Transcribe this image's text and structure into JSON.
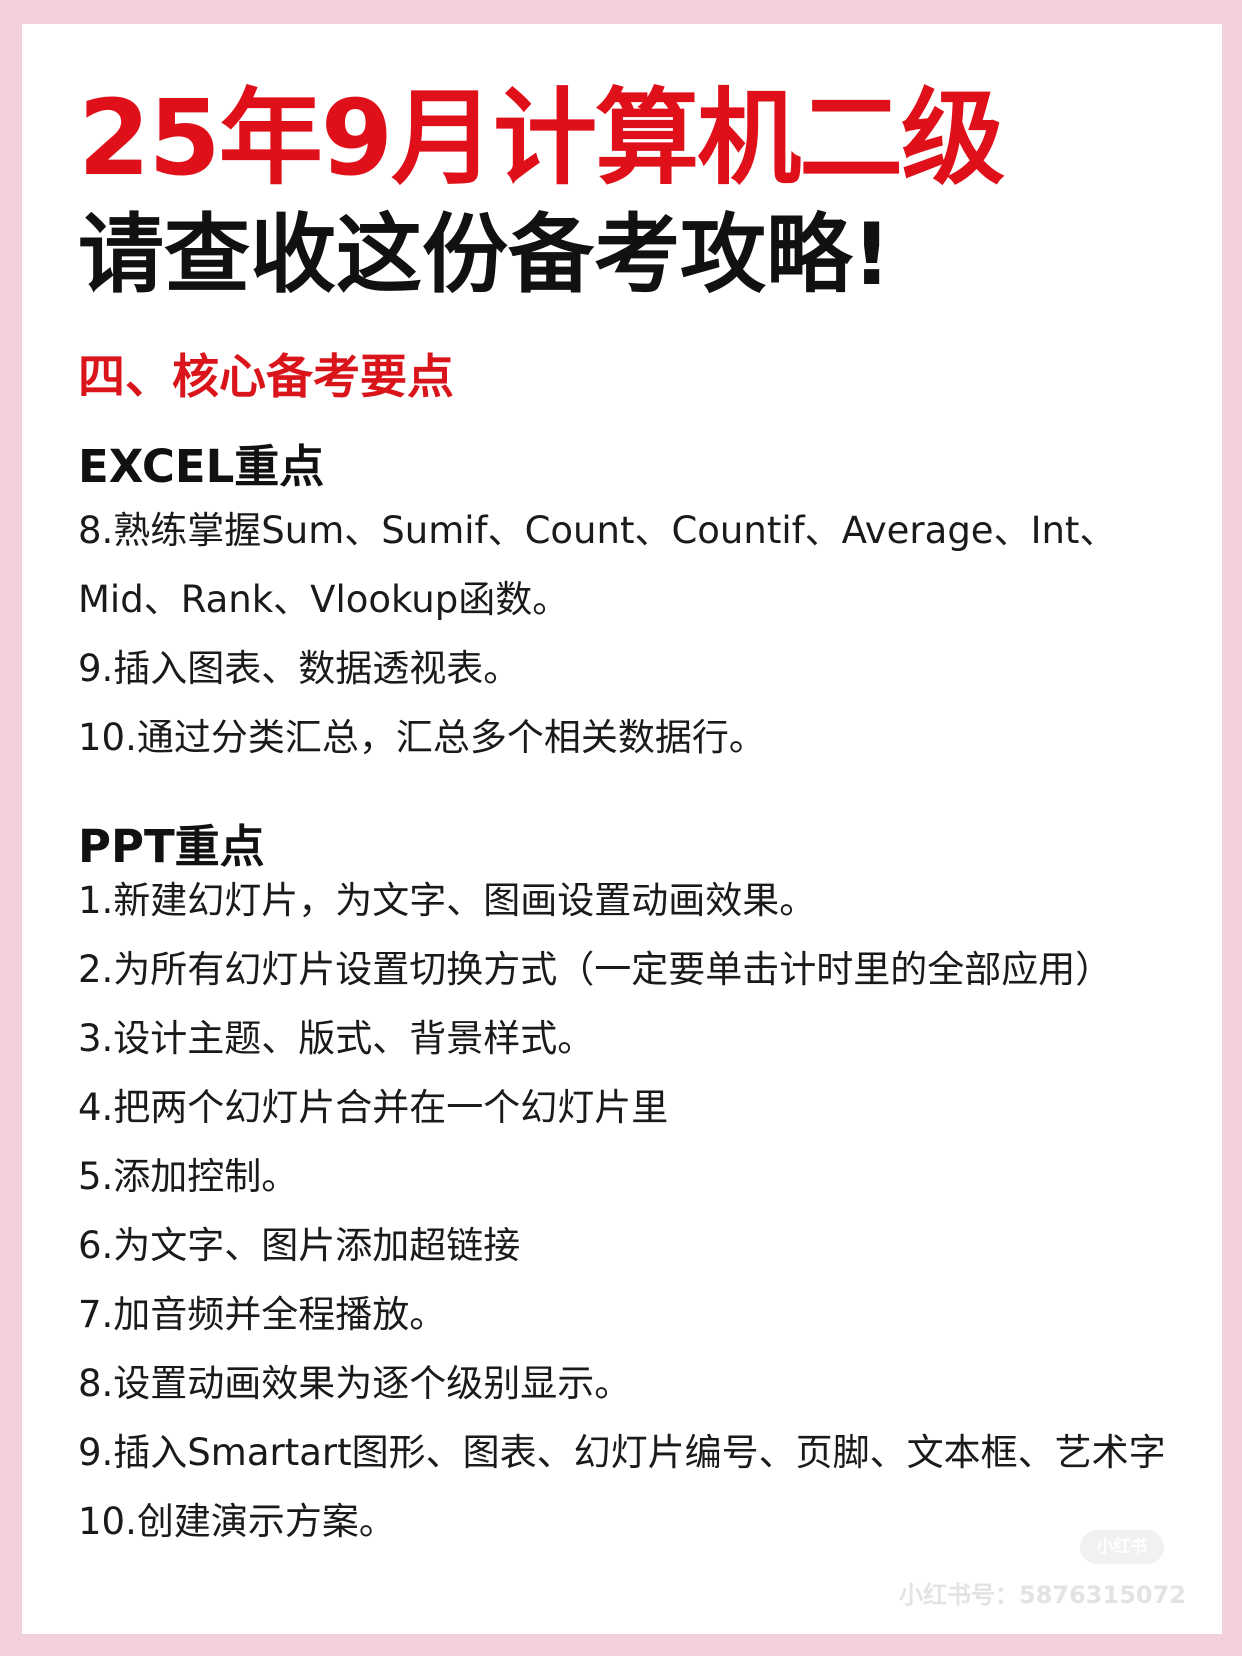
{
  "title": {
    "line1": "25年9月计算机二级",
    "line2": "请查收这份备考攻略!"
  },
  "section": {
    "heading": "四、核心备考要点"
  },
  "excel": {
    "heading": "EXCEL重点",
    "items": [
      "8.熟练掌握Sum、Sumif、Count、Countif、Average、Int、Mid、Rank、Vlookup函数。",
      "9.插入图表、数据透视表。",
      "10.通过分类汇总，汇总多个相关数据行。"
    ]
  },
  "ppt": {
    "heading": "PPT重点",
    "items": [
      "1.新建幻灯片，为文字、图画设置动画效果。",
      "2.为所有幻灯片设置切换方式（一定要单击计时里的全部应用）",
      "3.设计主题、版式、背景样式。",
      "4.把两个幻灯片合并在一个幻灯片里",
      "5.添加控制。",
      "6.为文字、图片添加超链接",
      "7.加音频并全程播放。",
      "8.设置动画效果为逐个级别显示。",
      "9.插入Smartart图形、图表、幻灯片编号、页脚、文本框、艺术字",
      "10.创建演示方案。"
    ]
  },
  "watermark": {
    "logo": "小红书",
    "text": "小红书号：5876315072"
  }
}
